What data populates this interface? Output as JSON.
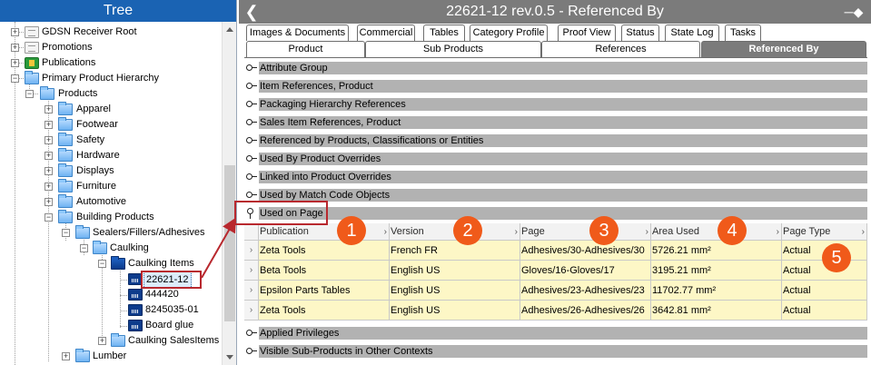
{
  "tree": {
    "title": "Tree",
    "nodes": [
      {
        "label": "GDSN Receiver Root"
      },
      {
        "label": "Promotions"
      },
      {
        "label": "Publications"
      },
      {
        "label": "Primary Product Hierarchy"
      },
      {
        "label": "Products"
      },
      {
        "label": "Apparel"
      },
      {
        "label": "Footwear"
      },
      {
        "label": "Safety"
      },
      {
        "label": "Hardware"
      },
      {
        "label": "Displays"
      },
      {
        "label": "Furniture"
      },
      {
        "label": "Automotive"
      },
      {
        "label": "Building Products"
      },
      {
        "label": "Sealers/Fillers/Adhesives"
      },
      {
        "label": "Caulking"
      },
      {
        "label": "Caulking Items"
      },
      {
        "label": "22621-12"
      },
      {
        "label": "444420"
      },
      {
        "label": "8245035-01"
      },
      {
        "label": "Board glue"
      },
      {
        "label": "Caulking SalesItems"
      },
      {
        "label": "Lumber"
      }
    ]
  },
  "header": {
    "title": "22621-12 rev.0.5 - Referenced By",
    "back_icon": "arrow-left-icon",
    "pin_icon": "pin-icon"
  },
  "tabs_row1": [
    "Images & Documents",
    "Commercial",
    "Tables",
    "Category Profile",
    "Proof View",
    "Status",
    "State Log",
    "Tasks"
  ],
  "tabs_row2": [
    "Product",
    "Sub Products",
    "References",
    "Referenced By"
  ],
  "active_tab": "Referenced By",
  "sections_top": [
    "Attribute Group",
    "Item References, Product",
    "Packaging Hierarchy References",
    "Sales Item References, Product",
    "Referenced by Products, Classifications or Entities",
    "Used By Product Overrides",
    "Linked into Product Overrides",
    "Used by Match Code Objects",
    "Used on Page"
  ],
  "sections_bottom": [
    "Applied Privileges",
    "Visible Sub-Products in Other Contexts"
  ],
  "grid": {
    "columns": [
      "Publication",
      "Version",
      "Page",
      "Area Used",
      "Page Type"
    ],
    "rows": [
      [
        "Zeta Tools",
        "French FR",
        "Adhesives/30-Adhesives/30",
        "5726.21 mm²",
        "Actual"
      ],
      [
        "Beta Tools",
        "English US",
        "Gloves/16-Gloves/17",
        "3195.21 mm²",
        "Actual"
      ],
      [
        "Epsilon Parts Tables",
        "English US",
        "Adhesives/23-Adhesives/23",
        "11702.77 mm²",
        "Actual"
      ],
      [
        "Zeta Tools",
        "English US",
        "Adhesives/26-Adhesives/26",
        "3642.81 mm²",
        "Actual"
      ]
    ]
  },
  "callouts": [
    "1",
    "2",
    "3",
    "4",
    "5"
  ],
  "colors": {
    "tree_header": "#1a63b3",
    "right_header": "#7b7b7b",
    "section_bar": "#b2b2b2",
    "grid_row": "#fdf7c6",
    "callout": "#f05a1a",
    "highlight": "#b8282e"
  }
}
